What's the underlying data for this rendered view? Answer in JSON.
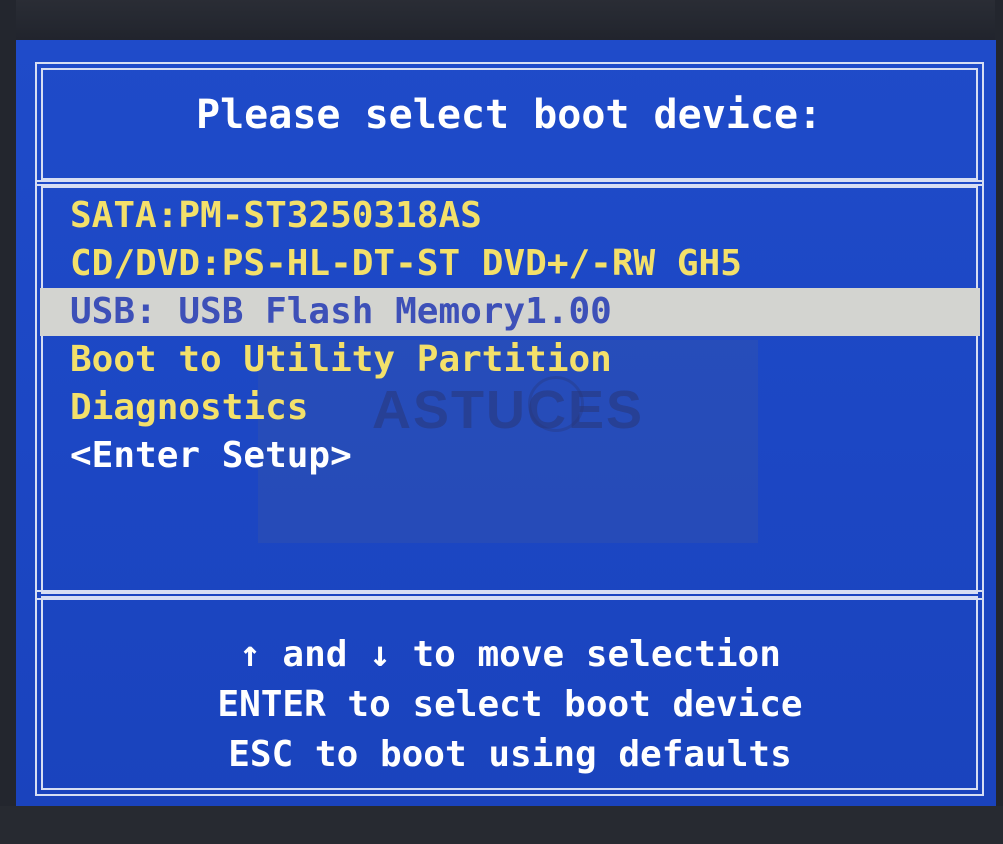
{
  "title": "Please select boot device:",
  "boot_devices": [
    {
      "label": "SATA:PM-ST3250318AS",
      "selected": false
    },
    {
      "label": "CD/DVD:PS-HL-DT-ST DVD+/-RW GH5",
      "selected": false
    },
    {
      "label": "USB: USB Flash Memory1.00",
      "selected": true
    },
    {
      "label": "Boot to Utility Partition",
      "selected": false
    },
    {
      "label": "Diagnostics",
      "selected": false
    },
    {
      "label": "<Enter Setup>",
      "selected": false
    }
  ],
  "watermark": "ASTUCES",
  "help": [
    "↑ and ↓ to move selection",
    "ENTER to select boot device",
    "ESC to boot using defaults"
  ],
  "colors": {
    "background": "#1f4bc9",
    "menu_text": "#f3e06a",
    "selection_bar": "#d3d4d0",
    "selected_text": "#3d50b8",
    "help_text": "#ffffff"
  }
}
